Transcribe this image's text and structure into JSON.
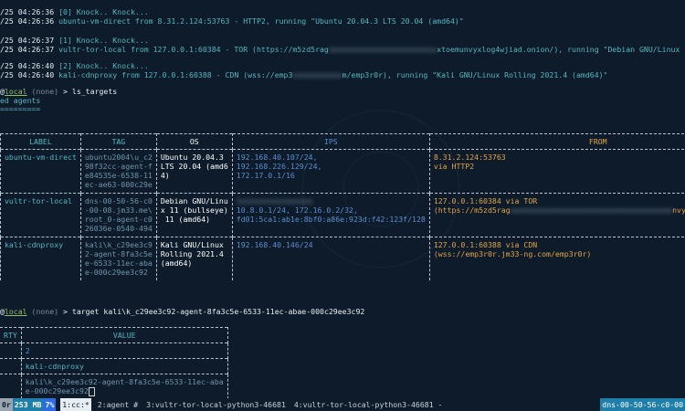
{
  "log": [
    {
      "ts": "/25 04:26:36",
      "tag": "[0] Knock.. Knock...",
      "detail": ""
    },
    {
      "ts": "/25 04:26:36",
      "tag": "",
      "detail": "ubuntu-vm-direct from 8.31.2.124:53763 - HTTP2, running \"Ubuntu 20.04.3 LTS 20.04 (amd64)\""
    },
    {
      "ts": "/25 04:26:37",
      "tag": "[1] Knock.. Knock...",
      "detail": ""
    },
    {
      "ts": "/25 04:26:37",
      "tag": "",
      "detail": "vultr-tor-local from 127.0.0.1:60384 - TOR (https://m5zd5rag",
      "detail_blur": "xxxxxxxxxxxxxxxxxxxxxxxx",
      "detail_tail": "xtoemunvyxlog4wjiad.onion/), running \"Debian GNU/Linux 11 (bullseye) 11 (a"
    },
    {
      "ts": "/25 04:26:40",
      "tag": "[2] Knock.. Knock...",
      "detail": ""
    },
    {
      "ts": "/25 04:26:40",
      "tag": "",
      "detail": "kali-cdnproxy from 127.0.0.1:60388 - CDN (wss://emp3",
      "detail_blur": "xxxxxxxxxxx",
      "detail_tail": "m/emp3r0r), running \"Kali GNU/Linux Rolling 2021.4 (amd64)\""
    }
  ],
  "prompt1": {
    "at": "@",
    "host": "local",
    "mod": " (none) ",
    "arrow": ">",
    "cmd": " ls_targets"
  },
  "listed": "ed agents",
  "underline": "=========",
  "table": {
    "headers": [
      "LABEL",
      "TAG",
      "OS",
      "IPS",
      "FROM"
    ],
    "rows": [
      {
        "label": "ubuntu-vm-direct",
        "tag": "ubuntu2004\\u_c2\n98f32cc-agent-f\ne84535e-6538-11\nec-ae63-000c29e",
        "os": "Ubuntu 20.04.3\nLTS 20.04 (amd6\n4)",
        "ips": "192.168.40.107/24,\n192.168.226.129/24,\n172.17.0.1/16",
        "from": "8.31.2.124:53763\nvia HTTP2"
      },
      {
        "label": "vultr-tor-local",
        "tag": "dns-00-50-56-c0\n-00-08.jm33.me\\\nroot_0-agent-c0\n26036e-0540-494",
        "os": "Debian GNU/Linu\nx 11 (bullseye)\n 11 (amd64)",
        "ips_blur": "1xxxxxxxxxxxxxxxx",
        "ips": "10.8.0.1/24, 172.16.0.2/32,\nfd01:5ca1:ab1e:8bf0:a86e:923d:f42:123f/128",
        "from": "127.0.0.1:60384 via TOR",
        "from2": "(https://m5zd5rag",
        "from2_blur": "xxxxxxxxxxxxxxxxxxxxxxxxxxxxxxxxxxxx",
        "from2_tail": "nvyxlog4wjiad.onion/"
      },
      {
        "label": "kali-cdnproxy",
        "tag": "kali\\k_c29ee3c9\n2-agent-8fa3c5e\ne-6533-11ec-aba\ne-000c29ee3c92",
        "os": "Kali GNU/Linux\nRolling 2021.4\n(amd64)",
        "ips": "192.168.40.146/24",
        "from": "127.0.0.1:60388 via CDN\n(wss://emp3r0r.jm33-ng.com/emp3r0r)"
      }
    ]
  },
  "prompt2": {
    "at": "@",
    "host": "local",
    "mod": " (none) ",
    "arrow": ">",
    "cmd": " target kali\\k_c29ee3c92-agent-8fa3c5e-6533-11ec-abae-000c29ee3c92"
  },
  "vtable": {
    "headers": [
      "RTY",
      "VALUE"
    ],
    "rows": [
      [
        "",
        "2"
      ],
      [
        "",
        "kali-cdnproxy"
      ],
      [
        "",
        "kali\\k_c29ee3c92-agent-8fa3c5e-6533-11ec-aba\ne-000c29ee3c92"
      ]
    ]
  },
  "status": {
    "session": "0r",
    "mem": "253 MB",
    "pct": "7%",
    "win1": "1:cc:*",
    "win2": "2:agent #",
    "win3": "3:vultr-tor-local-python3-46681",
    "win4": "4:vultr-tor-local-python3-46681 -",
    "host": "dns-00-50-56-c0-00"
  },
  "colors": {
    "bg": "#0d1b2a",
    "label": "#56b6c2",
    "ips": "#5a8fd0",
    "from": "#e5a444"
  }
}
